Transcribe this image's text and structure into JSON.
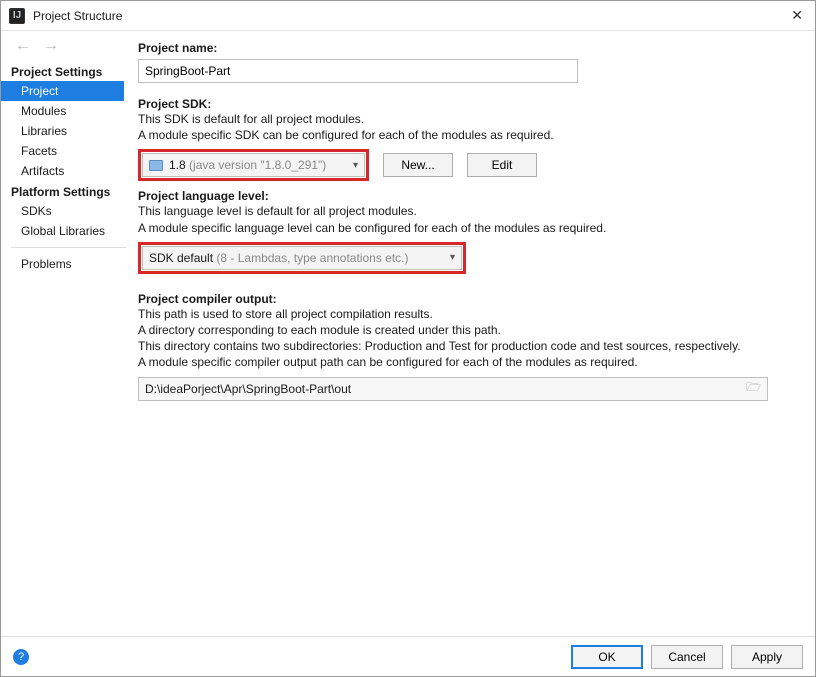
{
  "window": {
    "title": "Project Structure"
  },
  "sidebar": {
    "section1": "Project Settings",
    "section2": "Platform Settings",
    "items1": [
      {
        "label": "Project"
      },
      {
        "label": "Modules"
      },
      {
        "label": "Libraries"
      },
      {
        "label": "Facets"
      },
      {
        "label": "Artifacts"
      }
    ],
    "items2": [
      {
        "label": "SDKs"
      },
      {
        "label": "Global Libraries"
      }
    ],
    "problems": "Problems"
  },
  "content": {
    "projectNameLabel": "Project name:",
    "projectName": "SpringBoot-Part",
    "sdkLabel": "Project SDK:",
    "sdkLine1": "This SDK is default for all project modules.",
    "sdkLine2": "A module specific SDK can be configured for each of the modules as required.",
    "sdkValue": "1.8",
    "sdkHint": "(java version \"1.8.0_291\")",
    "newBtn": "New...",
    "editBtn": "Edit",
    "langLabel": "Project language level:",
    "langLine1": "This language level is default for all project modules.",
    "langLine2": "A module specific language level can be configured for each of the modules as required.",
    "langValue": "SDK default",
    "langHint": "(8 - Lambdas, type annotations etc.)",
    "outLabel": "Project compiler output:",
    "outLine1": "This path is used to store all project compilation results.",
    "outLine2": "A directory corresponding to each module is created under this path.",
    "outLine3": "This directory contains two subdirectories: Production and Test for production code and test sources, respectively.",
    "outLine4": "A module specific compiler output path can be configured for each of the modules as required.",
    "outPath": "D:\\ideaPorject\\Apr\\SpringBoot-Part\\out"
  },
  "footer": {
    "ok": "OK",
    "cancel": "Cancel",
    "apply": "Apply"
  }
}
